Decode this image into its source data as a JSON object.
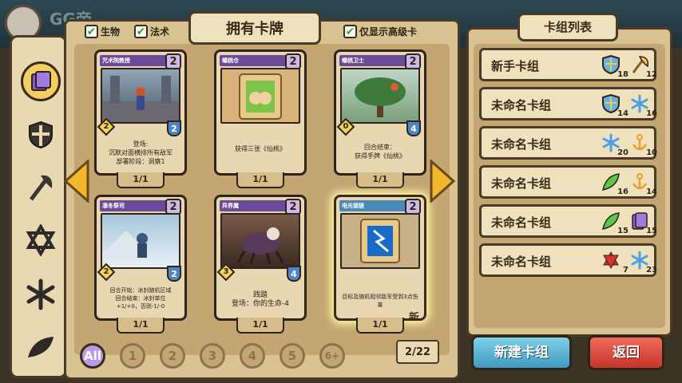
{
  "header": {
    "game_title": "GG帝"
  },
  "filters": {
    "creature": "生物",
    "spell": "法术",
    "advanced_only": "仅显示高级卡"
  },
  "panel_title": "拥有卡牌",
  "cards": [
    {
      "name": "咒术院教授",
      "cost": "2",
      "atk": "2",
      "hp": "2",
      "text": "登场:\n沉默对面横排所有敌军\n部署阶段：洞察1",
      "count": "1/1",
      "name_color": "#6c4a9a"
    },
    {
      "name": "蟠桃仓",
      "cost": "2",
      "text": "获得三张《仙桃》",
      "count": "1/1",
      "name_color": "#6c4a9a"
    },
    {
      "name": "蟠桃卫士",
      "cost": "2",
      "atk": "0",
      "hp": "4",
      "text": "回合结束：\n获得手牌《仙桃》",
      "count": "1/1",
      "name_color": "#6c4a9a"
    },
    {
      "name": "凛冬祭司",
      "cost": "2",
      "atk": "2",
      "hp": "2",
      "text": "回合开始：冰封随机区域\n回合结束：冰封单位\n+1/+0，否则-1/-0",
      "count": "1/1",
      "name_color": "#6c4a9a"
    },
    {
      "name": "异界魔",
      "cost": "2",
      "atk": "3",
      "hp": "4",
      "text": "践踏\n登场：你的生命-4",
      "count": "1/1",
      "name_color": "#6c4a9a"
    },
    {
      "name": "电光锁链",
      "cost": "2",
      "text": "目标及随机相邻敌军受到3点伤害",
      "count": "1/1",
      "new_label": "新",
      "name_color": "#4a8ab8"
    }
  ],
  "cost_filters": [
    "All",
    "1",
    "2",
    "3",
    "4",
    "5",
    "6+"
  ],
  "page_indicator": "2/22",
  "deck_panel": {
    "title": "卡组列表",
    "decks": [
      {
        "name": "新手卡组",
        "badges": [
          {
            "icon": "shield-icon",
            "count": "18"
          },
          {
            "icon": "axe-icon",
            "count": "12"
          }
        ]
      },
      {
        "name": "未命名卡组",
        "badges": [
          {
            "icon": "shield-icon",
            "count": "14"
          },
          {
            "icon": "snowflake-icon",
            "count": "16"
          }
        ]
      },
      {
        "name": "未命名卡组",
        "badges": [
          {
            "icon": "snowflake-icon",
            "count": "20"
          },
          {
            "icon": "anchor-icon",
            "count": "10"
          }
        ]
      },
      {
        "name": "未命名卡组",
        "badges": [
          {
            "icon": "leaf-icon",
            "count": "16"
          },
          {
            "icon": "anchor-icon",
            "count": "14"
          }
        ]
      },
      {
        "name": "未命名卡组",
        "badges": [
          {
            "icon": "leaf-icon",
            "count": "15"
          },
          {
            "icon": "cards-icon",
            "count": "15"
          }
        ]
      },
      {
        "name": "未命名卡组",
        "badges": [
          {
            "icon": "star-icon",
            "count": "7"
          },
          {
            "icon": "snowflake-icon",
            "count": "23"
          }
        ]
      }
    ]
  },
  "buttons": {
    "new_deck": "新建卡组",
    "back": "返回"
  }
}
